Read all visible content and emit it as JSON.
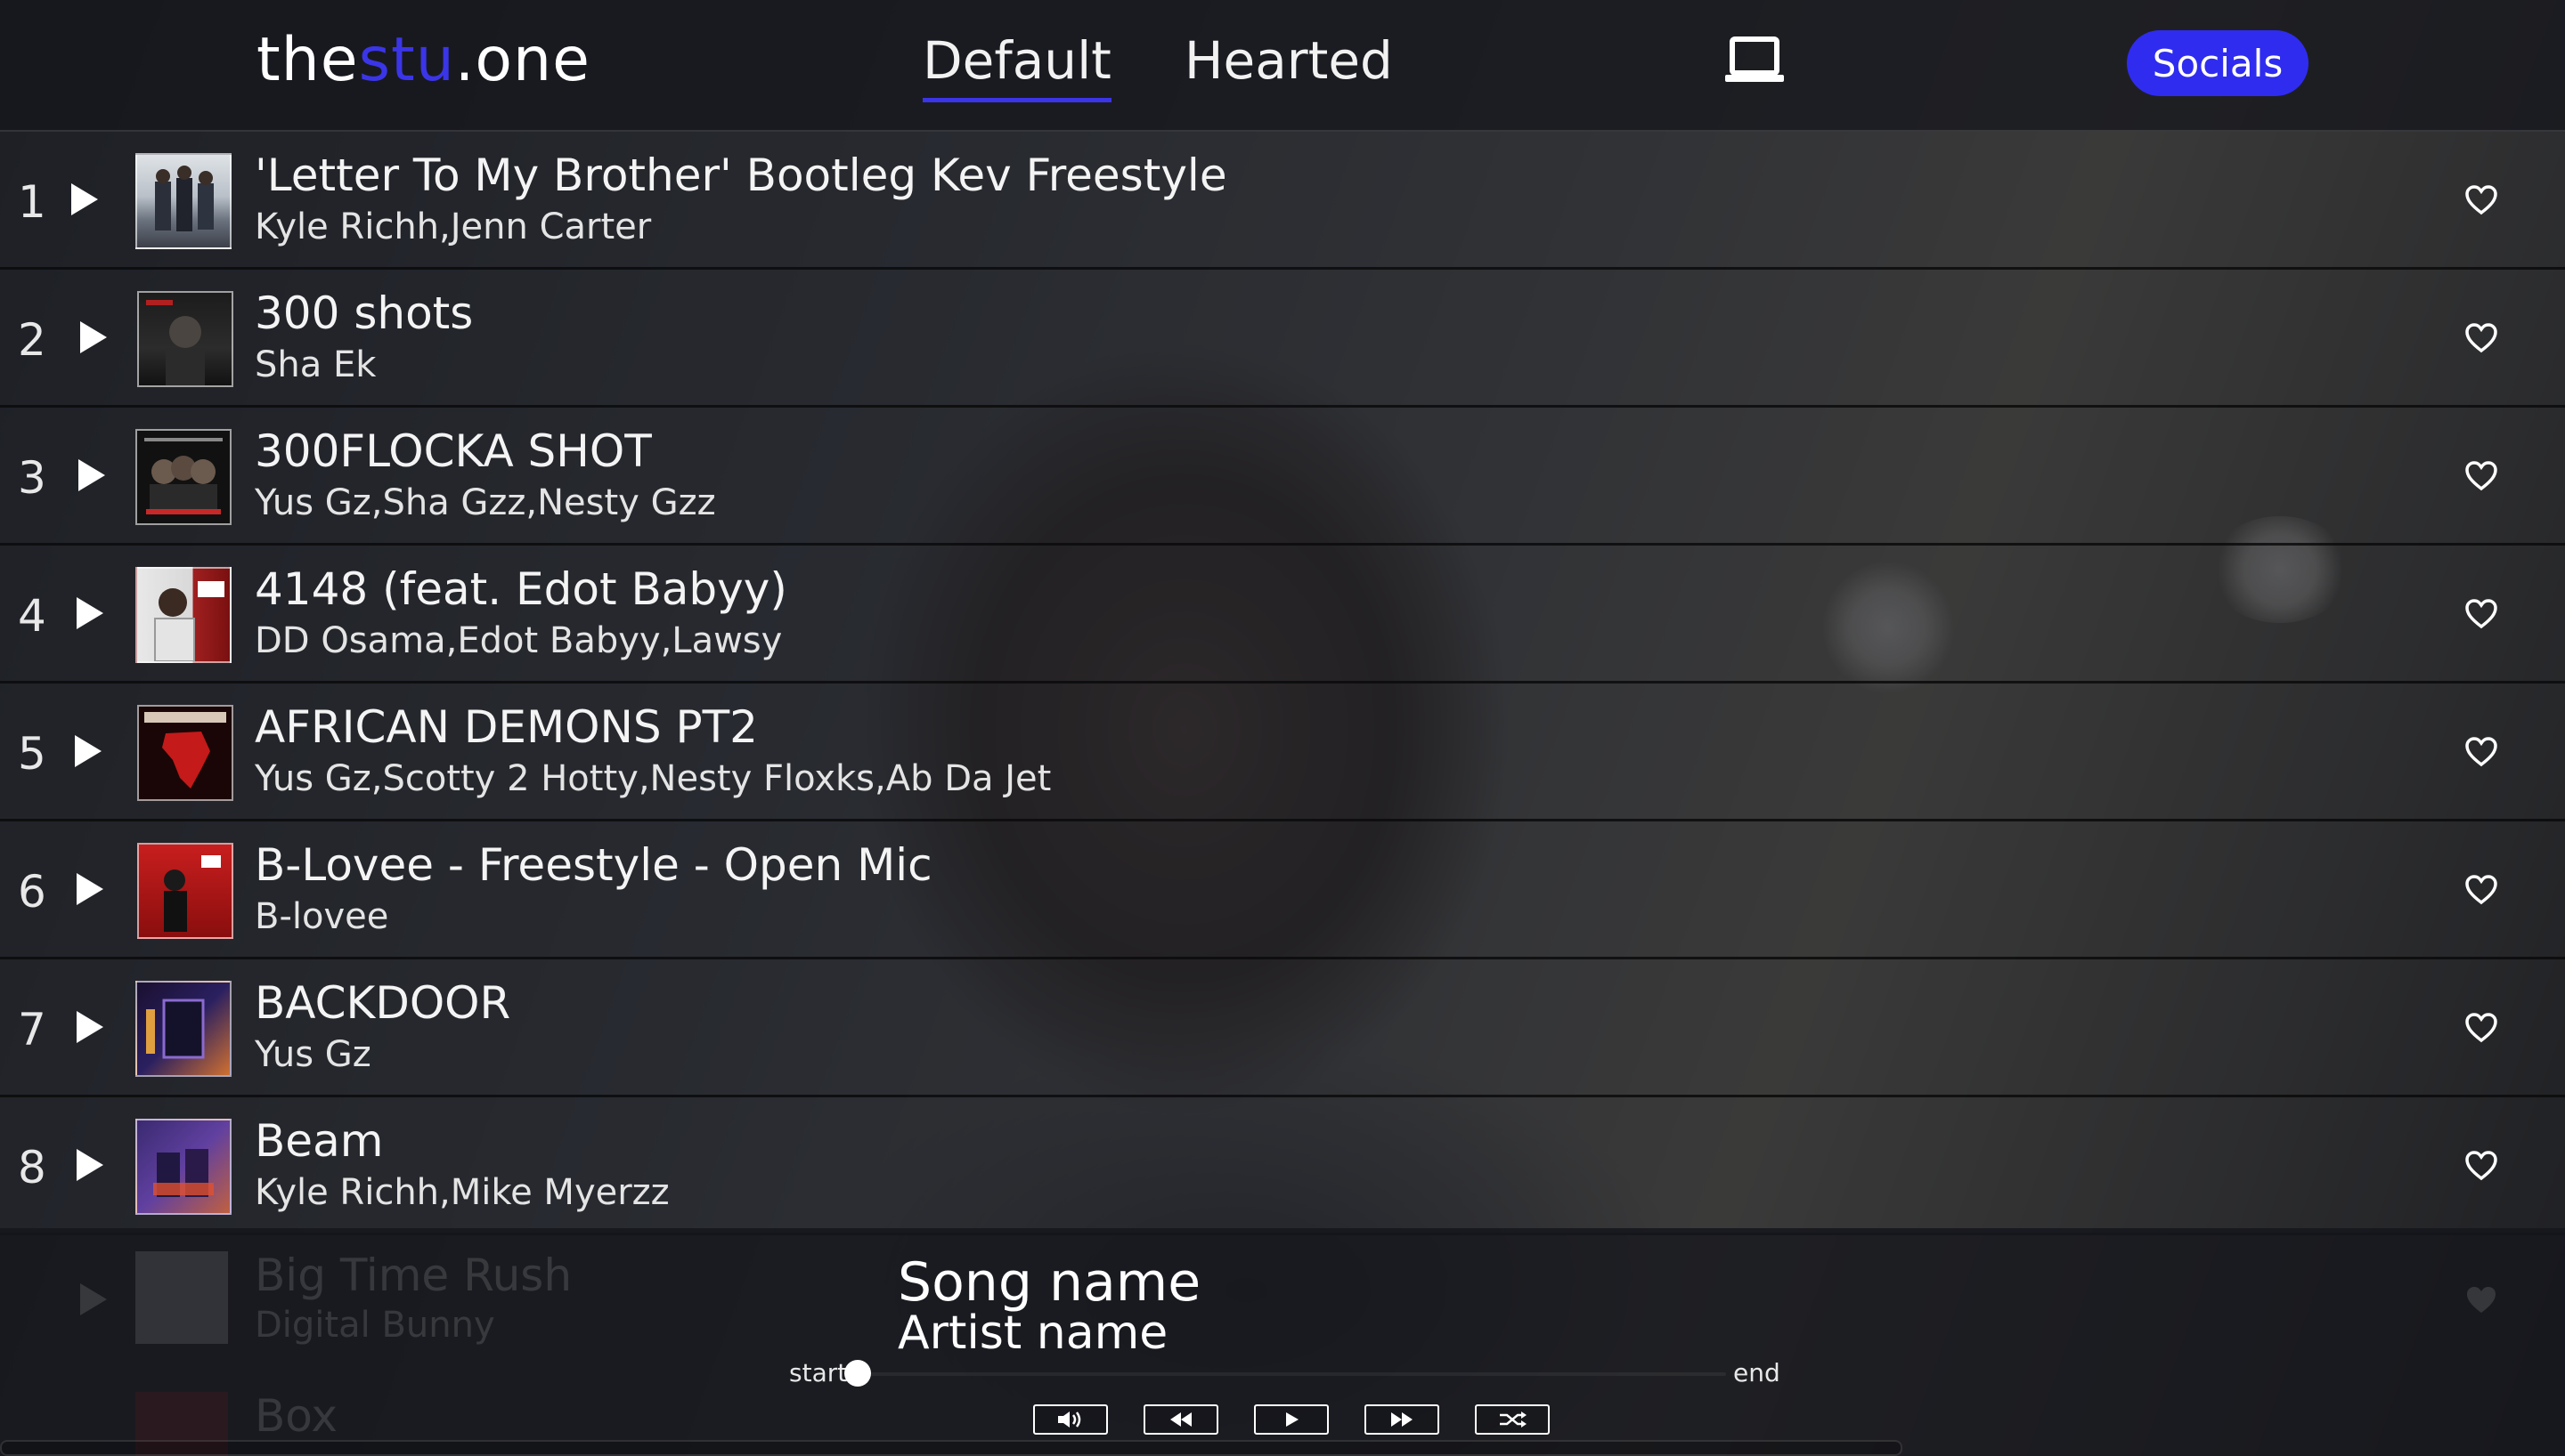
{
  "logo": {
    "part1": "the",
    "part2": "stu",
    "part3": ".one",
    "accent_color": "#3b35e8"
  },
  "tabs": [
    {
      "label": "Default",
      "active": true
    },
    {
      "label": "Hearted",
      "active": false
    }
  ],
  "device_icon": "laptop-icon",
  "socials_label": "Socials",
  "socials_color": "#2f2cf0",
  "tracks": [
    {
      "num": "1",
      "title": "'Letter To My Brother' Bootleg Kev Freestyle",
      "artist": "Kyle Richh,Jenn Carter"
    },
    {
      "num": "2",
      "title": "300 shots",
      "artist": "Sha Ek"
    },
    {
      "num": "3",
      "title": "300FLOCKA SHOT",
      "artist": "Yus Gz,Sha Gzz,Nesty Gzz"
    },
    {
      "num": "4",
      "title": "4148 (feat. Edot Babyy)",
      "artist": "DD Osama,Edot Babyy,Lawsy"
    },
    {
      "num": "5",
      "title": "AFRICAN DEMONS PT2",
      "artist": "Yus Gz,Scotty 2 Hotty,Nesty Floxks,Ab Da Jet"
    },
    {
      "num": "6",
      "title": "B-Lovee - Freestyle - Open Mic",
      "artist": "B-lovee"
    },
    {
      "num": "7",
      "title": "BACKDOOR",
      "artist": "Yus Gz"
    },
    {
      "num": "8",
      "title": "Beam",
      "artist": "Kyle Richh,Mike Myerzz"
    }
  ],
  "ghost_tracks": [
    {
      "title": "Big Time Rush",
      "artist": "Digital Bunny"
    },
    {
      "title": "Box",
      "artist": ""
    }
  ],
  "player": {
    "song_name": "Song name",
    "artist_name": "Artist name",
    "start_label": "start",
    "end_label": "end",
    "progress": 0,
    "controls": [
      "volume-icon",
      "rewind-icon",
      "play-icon",
      "fast-forward-icon",
      "shuffle-icon"
    ]
  }
}
